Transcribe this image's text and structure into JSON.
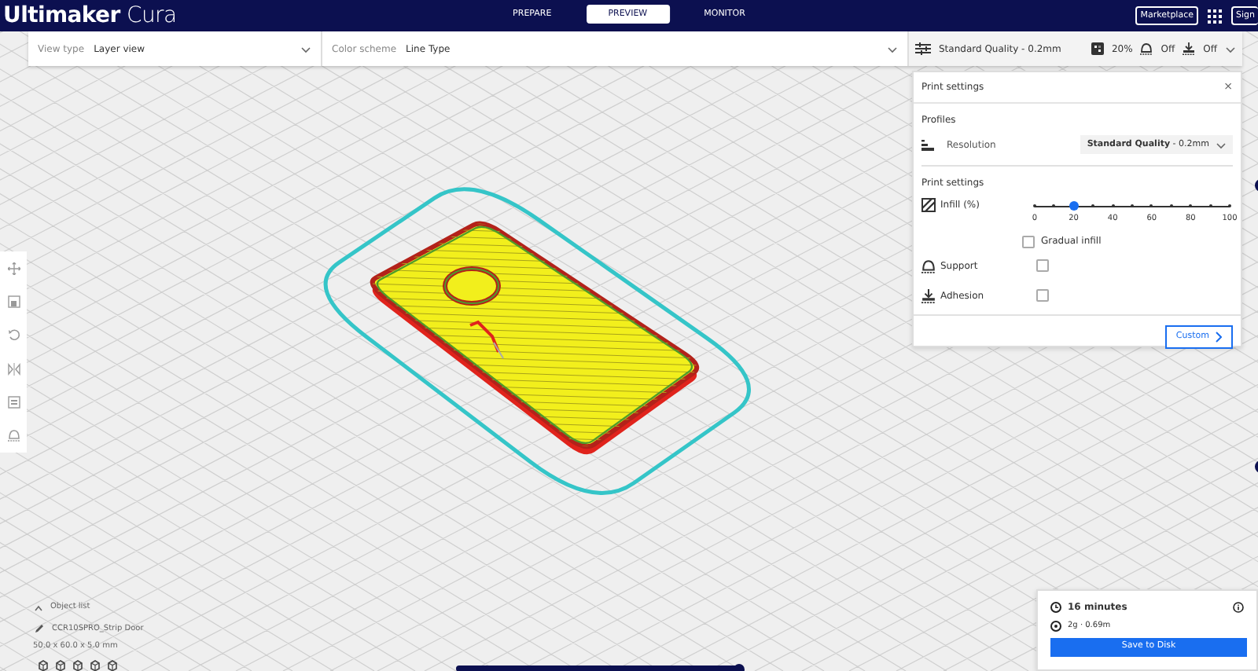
{
  "app": {
    "title_bold": "Ultimaker",
    "title_light": "Cura"
  },
  "stages": [
    {
      "label": "PREPARE",
      "selected": false
    },
    {
      "label": "PREVIEW",
      "selected": true
    },
    {
      "label": "MONITOR",
      "selected": false
    }
  ],
  "header_buttons": {
    "marketplace": "Marketplace",
    "account": "Sign"
  },
  "view_type": {
    "label": "View type",
    "value": "Layer view"
  },
  "color_scheme": {
    "label": "Color scheme",
    "value": "Line Type"
  },
  "summary": {
    "profile": "Standard Quality - 0.2mm",
    "infill": "20%",
    "support": "Off",
    "adhesion": "Off"
  },
  "print_settings": {
    "title": "Print settings",
    "close": "×",
    "profiles_heading": "Profiles",
    "resolution_label": "Resolution",
    "resolution_value": "**Standard Quality** - 0.2mm",
    "section_heading": "Print settings",
    "infill": {
      "label": "Infill (%)",
      "level": 0.2,
      "ticks": [
        "0",
        "20",
        "40",
        "60",
        "80",
        "100"
      ]
    },
    "gradual_infill": {
      "label": "Gradual infill",
      "checked": false
    },
    "support": {
      "label": "Support",
      "checked": false
    },
    "adhesion": {
      "label": "Adhesion",
      "checked": false
    },
    "custom_button": "Custom"
  },
  "object_list": {
    "heading": "Object list",
    "object_name": "CCR10SPRO_Strip Door",
    "dimensions": "50.0 x 60.0 x 5.0 mm"
  },
  "layer_slider": {
    "level": 1
  },
  "job": {
    "time": "16 minutes",
    "material": "2g · 0.69m",
    "save_button": "Save to Disk"
  }
}
